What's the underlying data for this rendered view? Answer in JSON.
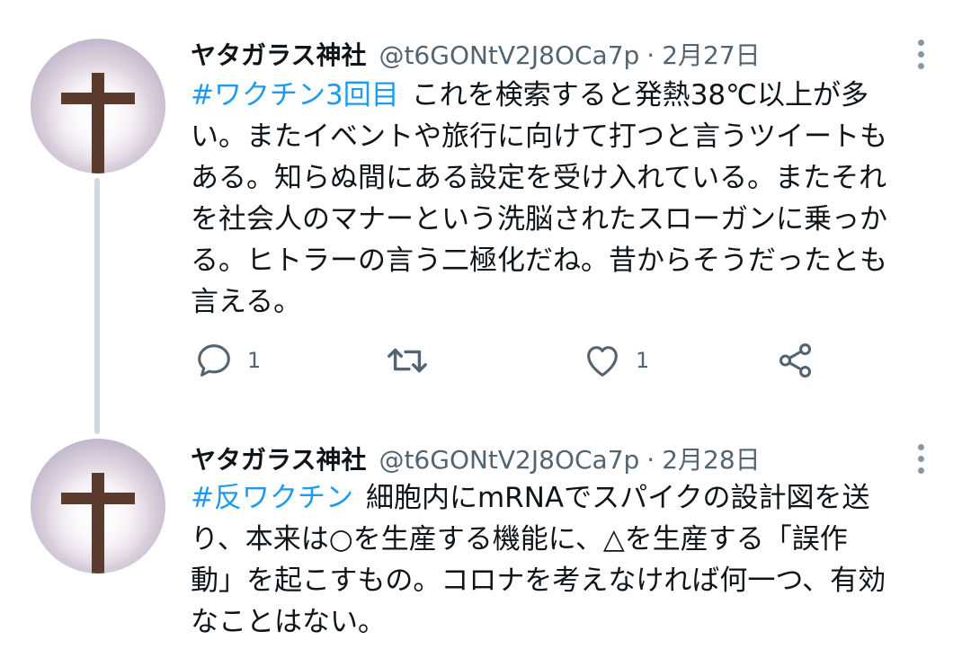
{
  "tweets": [
    {
      "name": "ヤタガラス神社",
      "handle": "@t6GONtV2J8OCa7p",
      "separator": "·",
      "date": "2月27日",
      "hashtag": "#ワクチン3回目",
      "lines": [
        "これを検索すると発熱38℃以上が多",
        "い。またイベントや旅行に向けて打つと言うツイートも",
        "ある。知らぬ間にある設定を受け入れている。またそれ",
        "を社会人のマナーという洗脳されたスローガンに乗っか",
        "る。ヒトラーの言う二極化だね。昔からそうだったとも",
        "言える。"
      ],
      "reply_count": "1",
      "like_count": "1"
    },
    {
      "name": "ヤタガラス神社",
      "handle": "@t6GONtV2J8OCa7p",
      "separator": "·",
      "date": "2月28日",
      "hashtag": "#反ワクチン",
      "lines": [
        "細胞内にmRNAでスパイクの設計図を送",
        "り、本来は○を生産する機能に、△を生産する「誤作",
        "動」を起こすもの。コロナを考えなければ何一つ、有効",
        "なことはない。"
      ]
    }
  ],
  "icons": {
    "avatar": "cross-avatar",
    "more": "more-vertical-icon",
    "reply": "reply-icon",
    "retweet": "retweet-icon",
    "like": "heart-icon",
    "share": "share-icon"
  },
  "colors": {
    "hashtag": "#1d9bf0",
    "secondary_text": "#536471",
    "primary_text": "#0f1419",
    "thread_line": "#cfd9de"
  }
}
